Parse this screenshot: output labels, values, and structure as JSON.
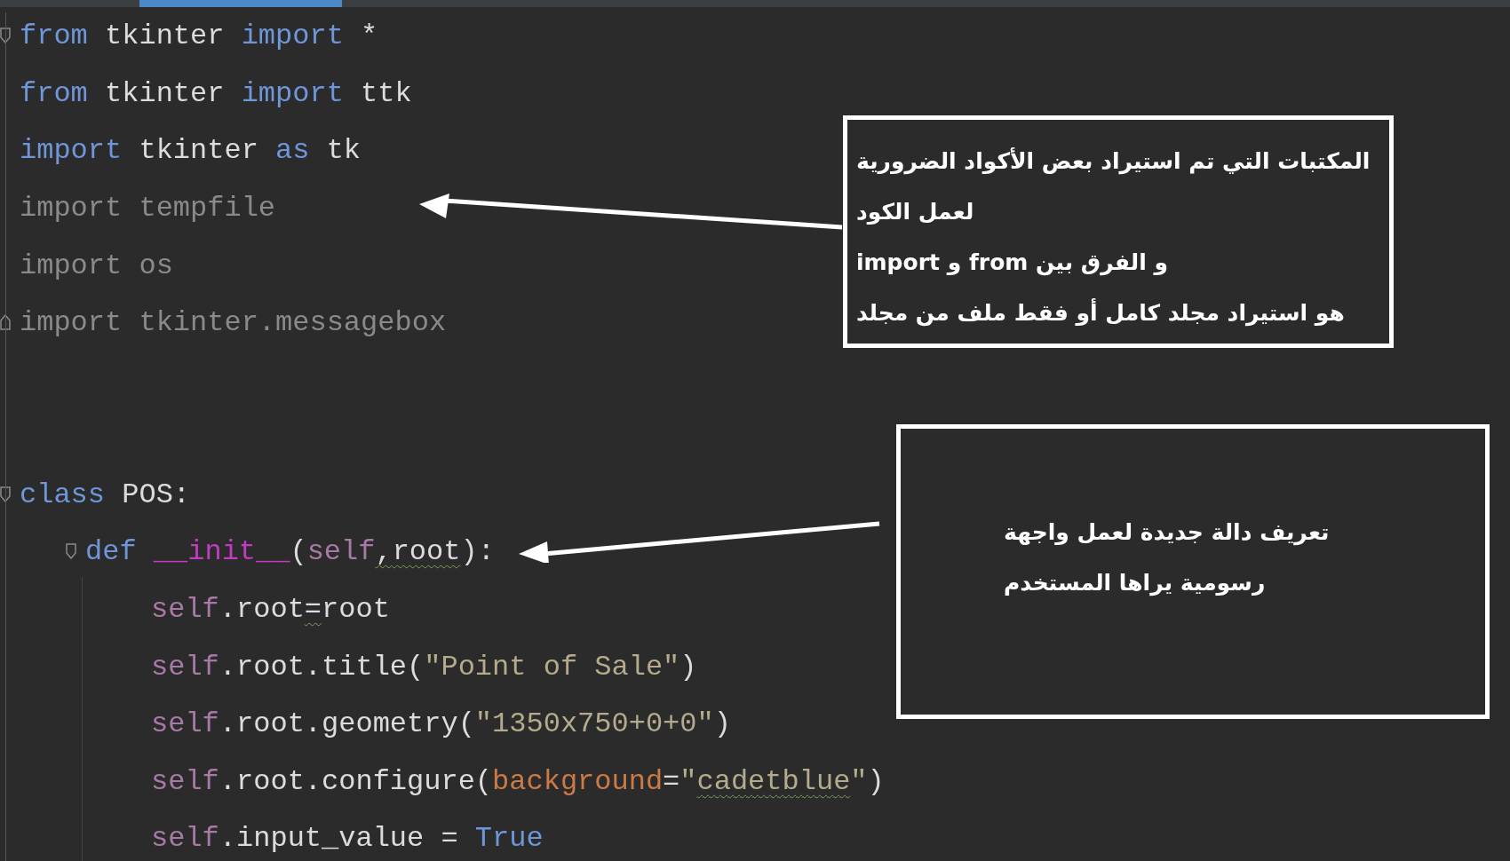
{
  "editor": {
    "blocks": [
      {
        "lines": [
          {
            "fold_open": true,
            "tokens": [
              {
                "t": "from",
                "kind": "keyword"
              },
              {
                "t": " tkinter ",
                "kind": "name"
              },
              {
                "t": "import",
                "kind": "keyword"
              },
              {
                "t": " *",
                "kind": "name"
              }
            ]
          },
          {
            "tokens": [
              {
                "t": "from",
                "kind": "keyword"
              },
              {
                "t": " tkinter ",
                "kind": "name"
              },
              {
                "t": "import",
                "kind": "keyword"
              },
              {
                "t": " ttk",
                "kind": "name"
              }
            ]
          },
          {
            "tokens": [
              {
                "t": "import",
                "kind": "keyword"
              },
              {
                "t": " tkinter ",
                "kind": "name"
              },
              {
                "t": "as",
                "kind": "keyword"
              },
              {
                "t": " tk",
                "kind": "name"
              }
            ]
          },
          {
            "tokens": [
              {
                "t": "import tempfile",
                "kind": "unused"
              }
            ]
          },
          {
            "tokens": [
              {
                "t": "import os",
                "kind": "unused"
              }
            ]
          },
          {
            "fold_close": true,
            "tokens": [
              {
                "t": "import tkinter.messagebox",
                "kind": "unused"
              }
            ]
          }
        ]
      },
      {
        "lines": [
          {
            "fold_open": true,
            "tokens": [
              {
                "t": "class",
                "kind": "keyword"
              },
              {
                "t": " POS:",
                "kind": "name"
              }
            ],
            "children": [
              {
                "fold_open": true,
                "tokens": [
                  {
                    "t": "def ",
                    "kind": "keyword"
                  },
                  {
                    "t": "__init__",
                    "kind": "dunder"
                  },
                  {
                    "t": "(",
                    "kind": "name"
                  },
                  {
                    "t": "self",
                    "kind": "self"
                  },
                  {
                    "t": ",",
                    "kind": "name",
                    "warn": true
                  },
                  {
                    "t": "root",
                    "kind": "name",
                    "warn": true
                  },
                  {
                    "t": "):",
                    "kind": "name"
                  }
                ],
                "children": [
                  {
                    "tokens": [
                      {
                        "t": "self",
                        "kind": "self"
                      },
                      {
                        "t": ".root",
                        "kind": "name"
                      },
                      {
                        "t": "=",
                        "kind": "name",
                        "warn": true
                      },
                      {
                        "t": "root",
                        "kind": "name"
                      }
                    ]
                  },
                  {
                    "tokens": [
                      {
                        "t": "self",
                        "kind": "self"
                      },
                      {
                        "t": ".root.title(",
                        "kind": "name"
                      },
                      {
                        "t": "\"Point of Sale\"",
                        "kind": "string"
                      },
                      {
                        "t": ")",
                        "kind": "name"
                      }
                    ]
                  },
                  {
                    "tokens": [
                      {
                        "t": "self",
                        "kind": "self"
                      },
                      {
                        "t": ".root.geometry(",
                        "kind": "name"
                      },
                      {
                        "t": "\"1350x750+0+0\"",
                        "kind": "string"
                      },
                      {
                        "t": ")",
                        "kind": "name"
                      }
                    ]
                  },
                  {
                    "tokens": [
                      {
                        "t": "self",
                        "kind": "self"
                      },
                      {
                        "t": ".root.configure(",
                        "kind": "name"
                      },
                      {
                        "t": "background",
                        "kind": "param"
                      },
                      {
                        "t": "=",
                        "kind": "name"
                      },
                      {
                        "t": "\"",
                        "kind": "string"
                      },
                      {
                        "t": "cadetblue",
                        "kind": "string",
                        "warn": true
                      },
                      {
                        "t": "\"",
                        "kind": "string"
                      },
                      {
                        "t": ")",
                        "kind": "name"
                      }
                    ]
                  },
                  {
                    "tokens": [
                      {
                        "t": "self",
                        "kind": "self"
                      },
                      {
                        "t": ".input_value = ",
                        "kind": "name"
                      },
                      {
                        "t": "True",
                        "kind": "keyword"
                      }
                    ]
                  }
                ]
              }
            ]
          }
        ]
      }
    ]
  },
  "annotations": [
    {
      "lines": [
        "المكتبات التي تم استيراد بعض الأكواد الضرورية",
        "لعمل الكود",
        "و الفرق بين from و import",
        "هو استيراد مجلد كامل أو فقط ملف من مجلد"
      ]
    },
    {
      "lines": [
        "تعريف دالة جديدة لعمل واجهة",
        "رسومية يراها المستخدم"
      ]
    }
  ]
}
